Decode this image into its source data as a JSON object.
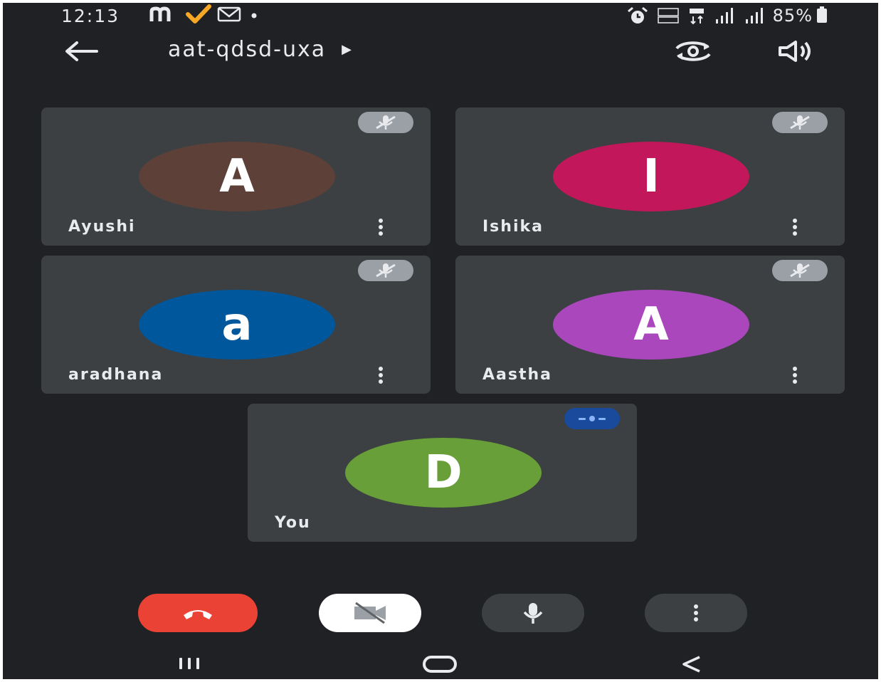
{
  "status_bar": {
    "time": "12:13",
    "left_icons": [
      "meet-logo-icon",
      "check-icon",
      "gmail-icon",
      "dot-icon"
    ],
    "right_icons": [
      "alarm-icon",
      "volte-icon",
      "lte-icon",
      "signal-icon",
      "signal-icon"
    ],
    "battery": "85%"
  },
  "header": {
    "meeting_code": "aat-qdsd-uxa",
    "icons": [
      "back-arrow-icon",
      "meeting-details-arrow-icon",
      "switch-camera-icon",
      "speaker-icon"
    ]
  },
  "participants": [
    {
      "name": "Ayushi",
      "initial": "A",
      "color": "#5d4037",
      "mic": "muted"
    },
    {
      "name": "Ishika",
      "initial": "I",
      "color": "#c2185b",
      "mic": "muted"
    },
    {
      "name": "aradhana",
      "initial": "a",
      "color": "#01579b",
      "mic": "muted"
    },
    {
      "name": "Aastha",
      "initial": "A",
      "color": "#ab47bc",
      "mic": "muted"
    }
  ],
  "self": {
    "name": "You",
    "initial": "D",
    "color": "#689f38",
    "mic": "active"
  },
  "controls": {
    "end_call": {
      "icon": "phone-hangup-icon",
      "color": "#ea4335"
    },
    "camera": {
      "icon": "video-off-icon",
      "state": "off"
    },
    "microphone": {
      "icon": "mic-icon",
      "state": "on"
    },
    "more": {
      "icon": "more-vert-icon"
    }
  },
  "nav_bar": {
    "icons": [
      "recent-apps-icon",
      "home-icon",
      "back-icon"
    ]
  },
  "colors": {
    "background": "#202124",
    "tile": "#3c4043",
    "text": "#e8eaed"
  }
}
